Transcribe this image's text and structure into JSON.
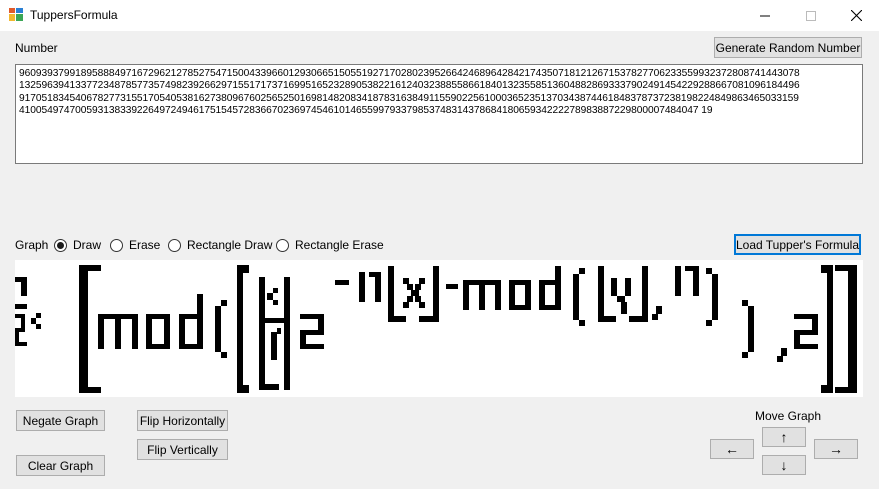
{
  "window": {
    "title": "TuppersFormula",
    "controls": {
      "minimize": "—",
      "maximize": "☐",
      "close": "✕"
    }
  },
  "number_label": "Number",
  "generate_button": "Generate Random Number",
  "number_lines": [
    "9609393799189588849716729621278527547150043396601293066515055192717028023952664246896428421743507181212671537827706233559932372808741443078",
    "1325963941337723487857735749823926629715517173716995165232890538221612403238855866184013235585136048828693337902491454229288667081096184496",
    "9170518345406782773155170540538162738096760256525016981482083418783163849115590225610003652351370343874461848378737238198224849863465033159",
    "4100549747005931383392264972494617515457283667023697454610146559979337985374831437868418065934222278983887229800007484047 19"
  ],
  "graph_label": "Graph",
  "modes": [
    {
      "label": "Draw",
      "selected": true
    },
    {
      "label": "Erase",
      "selected": false
    },
    {
      "label": "Rectangle Draw",
      "selected": false
    },
    {
      "label": "Rectangle Erase",
      "selected": false
    }
  ],
  "load_button": "Load Tupper's Formula",
  "buttons": {
    "negate": "Negate Graph",
    "clear": "Clear Graph",
    "flip_h": "Flip Horizontally",
    "flip_v": "Flip Vertically"
  },
  "move": {
    "label": "Move Graph",
    "up": "↑",
    "down": "↓",
    "left": "←",
    "right": "→"
  },
  "colors": {
    "accent": "#0078d7",
    "pixel": "#000000",
    "canvas_bg": "#ffffff"
  }
}
